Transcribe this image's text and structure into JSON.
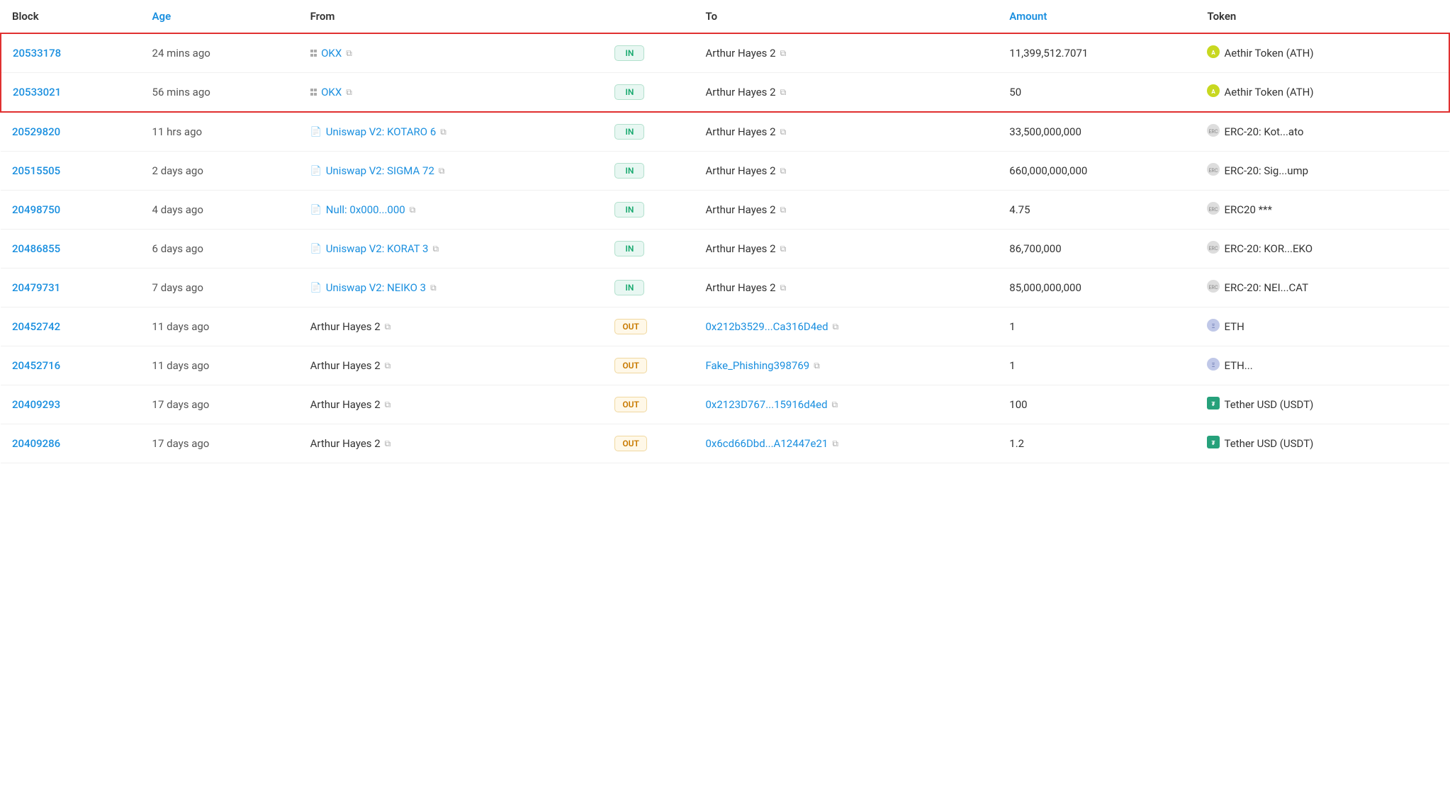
{
  "table": {
    "headers": [
      {
        "label": "Block",
        "class": ""
      },
      {
        "label": "Age",
        "class": "blue"
      },
      {
        "label": "From",
        "class": ""
      },
      {
        "label": "",
        "class": ""
      },
      {
        "label": "To",
        "class": ""
      },
      {
        "label": "Amount",
        "class": "blue"
      },
      {
        "label": "Token",
        "class": ""
      }
    ],
    "rows": [
      {
        "id": "row-1",
        "highlighted": true,
        "block": "20533178",
        "age": "24 mins ago",
        "from_type": "okx",
        "from_label": "OKX",
        "from_link": true,
        "direction": "IN",
        "to_type": "plain",
        "to_label": "Arthur Hayes 2",
        "to_link": false,
        "amount": "11,399,512.7071",
        "token_type": "ath",
        "token_label": "Aethir Token (ATH)"
      },
      {
        "id": "row-2",
        "highlighted": true,
        "block": "20533021",
        "age": "56 mins ago",
        "from_type": "okx",
        "from_label": "OKX",
        "from_link": true,
        "direction": "IN",
        "to_type": "plain",
        "to_label": "Arthur Hayes 2",
        "to_link": false,
        "amount": "50",
        "token_type": "ath",
        "token_label": "Aethir Token (ATH)"
      },
      {
        "id": "row-3",
        "highlighted": false,
        "block": "20529820",
        "age": "11 hrs ago",
        "from_type": "contract",
        "from_label": "Uniswap V2: KOTARO 6",
        "from_link": true,
        "direction": "IN",
        "to_type": "plain",
        "to_label": "Arthur Hayes 2",
        "to_link": false,
        "amount": "33,500,000,000",
        "token_type": "erc",
        "token_label": "ERC-20: Kot...ato"
      },
      {
        "id": "row-4",
        "highlighted": false,
        "block": "20515505",
        "age": "2 days ago",
        "from_type": "contract",
        "from_label": "Uniswap V2: SIGMA 72",
        "from_link": true,
        "direction": "IN",
        "to_type": "plain",
        "to_label": "Arthur Hayes 2",
        "to_link": false,
        "amount": "660,000,000,000",
        "token_type": "erc",
        "token_label": "ERC-20: Sig...ump"
      },
      {
        "id": "row-5",
        "highlighted": false,
        "block": "20498750",
        "age": "4 days ago",
        "from_type": "contract",
        "from_label": "Null: 0x000...000",
        "from_link": true,
        "direction": "IN",
        "to_type": "plain",
        "to_label": "Arthur Hayes 2",
        "to_link": false,
        "amount": "4.75",
        "token_type": "erc",
        "token_label": "ERC20 ***"
      },
      {
        "id": "row-6",
        "highlighted": false,
        "block": "20486855",
        "age": "6 days ago",
        "from_type": "contract",
        "from_label": "Uniswap V2: KORAT 3",
        "from_link": true,
        "direction": "IN",
        "to_type": "plain",
        "to_label": "Arthur Hayes 2",
        "to_link": false,
        "amount": "86,700,000",
        "token_type": "erc",
        "token_label": "ERC-20: KOR...EKO"
      },
      {
        "id": "row-7",
        "highlighted": false,
        "block": "20479731",
        "age": "7 days ago",
        "from_type": "contract",
        "from_label": "Uniswap V2: NEIKO 3",
        "from_link": true,
        "direction": "IN",
        "to_type": "plain",
        "to_label": "Arthur Hayes 2",
        "to_link": false,
        "amount": "85,000,000,000",
        "token_type": "erc",
        "token_label": "ERC-20: NEI...CAT"
      },
      {
        "id": "row-8",
        "highlighted": false,
        "block": "20452742",
        "age": "11 days ago",
        "from_type": "plain",
        "from_label": "Arthur Hayes 2",
        "from_link": false,
        "direction": "OUT",
        "to_type": "link",
        "to_label": "0x212b3529...Ca316D4ed",
        "to_link": true,
        "amount": "1",
        "token_type": "eth",
        "token_label": "ETH"
      },
      {
        "id": "row-9",
        "highlighted": false,
        "block": "20452716",
        "age": "11 days ago",
        "from_type": "plain",
        "from_label": "Arthur Hayes 2",
        "from_link": false,
        "direction": "OUT",
        "to_type": "link",
        "to_label": "Fake_Phishing398769",
        "to_link": true,
        "amount": "1",
        "token_type": "eth",
        "token_label": "ETH..."
      },
      {
        "id": "row-10",
        "highlighted": false,
        "block": "20409293",
        "age": "17 days ago",
        "from_type": "plain",
        "from_label": "Arthur Hayes 2",
        "from_link": false,
        "direction": "OUT",
        "to_type": "link",
        "to_label": "0x2123D767...15916d4ed",
        "to_link": true,
        "amount": "100",
        "token_type": "usdt",
        "token_label": "Tether USD (USDT)"
      },
      {
        "id": "row-11",
        "highlighted": false,
        "block": "20409286",
        "age": "17 days ago",
        "from_type": "plain",
        "from_label": "Arthur Hayes 2",
        "from_link": false,
        "direction": "OUT",
        "to_type": "link",
        "to_label": "0x6cd66Dbd...A12447e21",
        "to_link": true,
        "amount": "1.2",
        "token_type": "usdt",
        "token_label": "Tether USD (USDT)"
      }
    ]
  }
}
